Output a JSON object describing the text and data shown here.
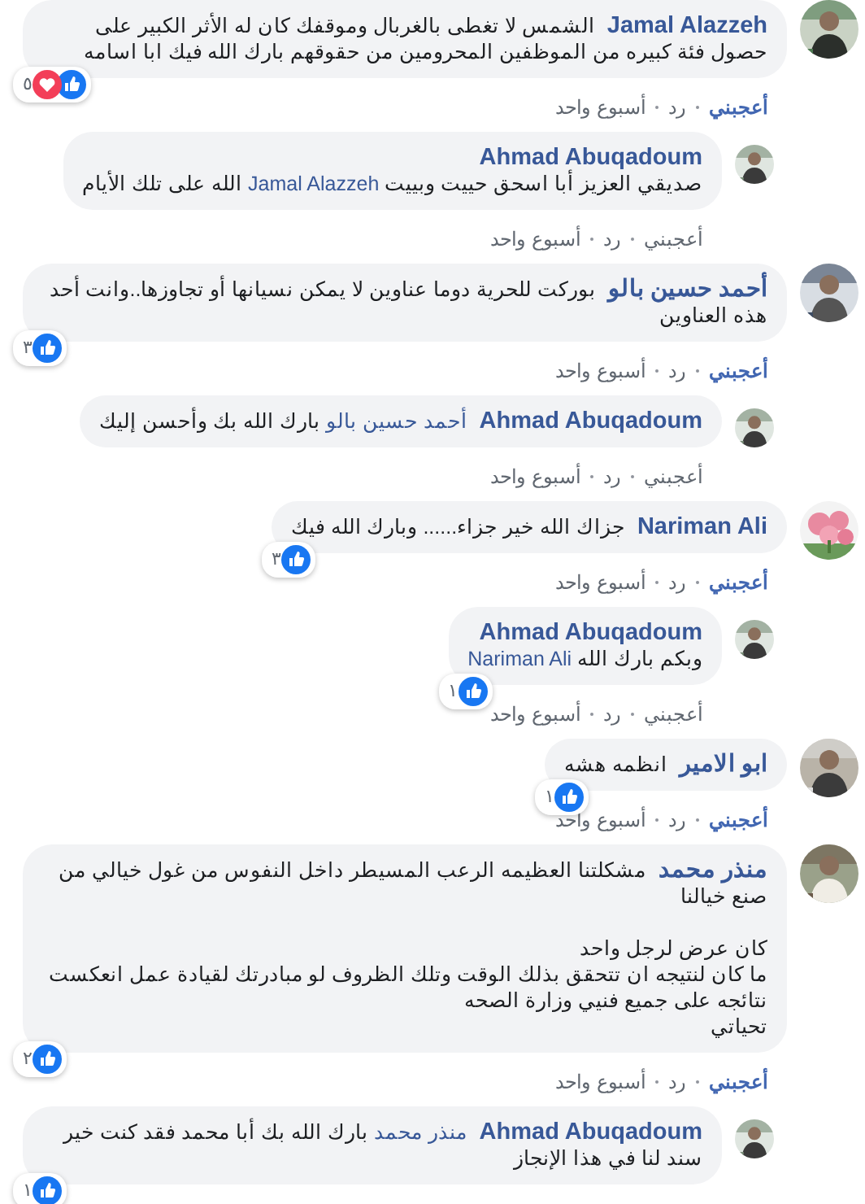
{
  "comments": [
    {
      "author": "Jamal Alazzeh",
      "body": [
        {
          "kind": "plain",
          "text": "الشمس لا تغطى بالغربال وموقفك كان له الأثر الكبير على حصول فئة كبيره من الموظفين المحرومين من حقوقهم بارك الله فيك ابا اسامه"
        }
      ],
      "reactions": {
        "like": true,
        "love": true,
        "count": "٥"
      },
      "actions": {
        "like": {
          "label": "أعجبني",
          "selected": true
        },
        "reply": "رد",
        "time": "أسبوع واحد"
      },
      "children": [
        {
          "author": "Ahmad Abuqadoum",
          "name_line": true,
          "body": [
            {
              "kind": "plain",
              "text": "صديقي العزيز أبا اسحق حييت وبييت "
            },
            {
              "kind": "mention",
              "text": "Jamal Alazzeh"
            },
            {
              "kind": "plain",
              "text": " الله على تلك الأيام"
            }
          ],
          "actions": {
            "like": {
              "label": "أعجبني",
              "selected": false
            },
            "reply": "رد",
            "time": "أسبوع واحد"
          }
        }
      ]
    },
    {
      "author": "أحمد حسين بالو",
      "body": [
        {
          "kind": "plain",
          "text": "بوركت للحرية دوما عناوين لا يمكن نسيانها أو تجاوزها..وانت أحد هذه العناوين"
        }
      ],
      "reactions": {
        "like": true,
        "count": "٣"
      },
      "actions": {
        "like": {
          "label": "أعجبني",
          "selected": true
        },
        "reply": "رد",
        "time": "أسبوع واحد"
      },
      "children": [
        {
          "author": "Ahmad Abuqadoum",
          "body": [
            {
              "kind": "mention",
              "text": "أحمد حسين بالو"
            },
            {
              "kind": "plain",
              "text": " بارك الله بك وأحسن إليك"
            }
          ],
          "actions": {
            "like": {
              "label": "أعجبني",
              "selected": false
            },
            "reply": "رد",
            "time": "أسبوع واحد"
          }
        }
      ]
    },
    {
      "author": "Nariman Ali",
      "body": [
        {
          "kind": "plain",
          "text": "جزاك الله خير جزاء...... وبارك الله فيك"
        }
      ],
      "reactions": {
        "like": true,
        "count": "٣"
      },
      "actions": {
        "like": {
          "label": "أعجبني",
          "selected": true
        },
        "reply": "رد",
        "time": "أسبوع واحد"
      },
      "children": [
        {
          "author": "Ahmad Abuqadoum",
          "name_line": true,
          "body": [
            {
              "kind": "plain",
              "text": "وبكم بارك الله "
            },
            {
              "kind": "mention",
              "text": "Nariman Ali"
            }
          ],
          "reactions": {
            "like": true,
            "count": "١"
          },
          "actions": {
            "like": {
              "label": "أعجبني",
              "selected": false
            },
            "reply": "رد",
            "time": "أسبوع واحد"
          }
        }
      ]
    },
    {
      "author": "ابو الامير",
      "body": [
        {
          "kind": "plain",
          "text": "انظمه هشه"
        }
      ],
      "reactions": {
        "like": true,
        "count": "١"
      },
      "actions": {
        "like": {
          "label": "أعجبني",
          "selected": true
        },
        "reply": "رد",
        "time": "أسبوع واحد"
      }
    },
    {
      "author": "منذر محمد",
      "body": [
        {
          "kind": "plain",
          "text": "مشكلتنا العظيمه الرعب المسيطر داخل النفوس من غول خيالي من صنع خيالنا\n\nكان عرض لرجل واحد\nما كان لنتيجه ان تتحقق بذلك الوقت وتلك الظروف لو مبادرتك لقيادة عمل انعكست نتائجه على جميع فنيي وزارة الصحه\nتحياتي"
        }
      ],
      "reactions": {
        "like": true,
        "count": "٢"
      },
      "actions": {
        "like": {
          "label": "أعجبني",
          "selected": true
        },
        "reply": "رد",
        "time": "أسبوع واحد"
      },
      "children": [
        {
          "author": "Ahmad Abuqadoum",
          "body": [
            {
              "kind": "mention",
              "text": "منذر محمد"
            },
            {
              "kind": "plain",
              "text": " بارك الله بك أبا محمد فقد كنت خير سند لنا في هذا الإنجاز"
            }
          ],
          "reactions": {
            "like": true,
            "count": "١"
          }
        }
      ]
    }
  ]
}
